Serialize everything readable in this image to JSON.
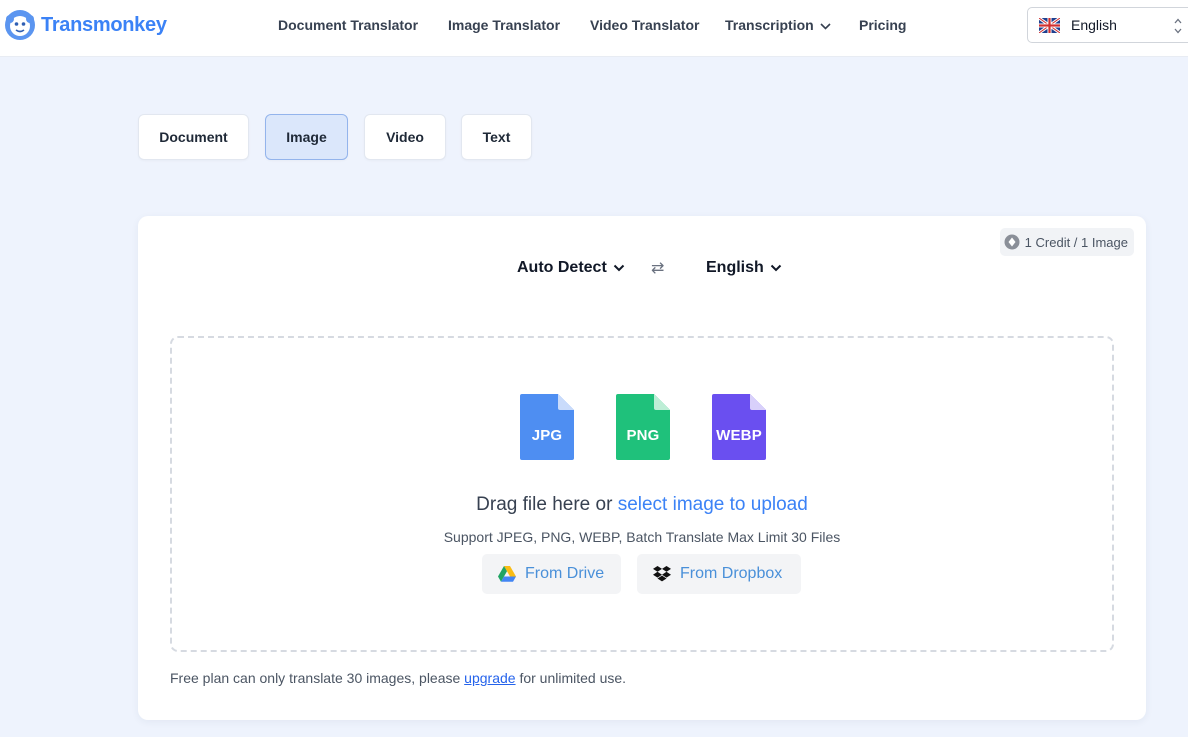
{
  "header": {
    "brand": "Transmonkey",
    "nav": [
      {
        "label": "Document Translator"
      },
      {
        "label": "Image Translator"
      },
      {
        "label": "Video Translator"
      },
      {
        "label": "Transcription"
      },
      {
        "label": "Pricing"
      }
    ],
    "language": "English"
  },
  "tabs": [
    {
      "label": "Document",
      "active": false
    },
    {
      "label": "Image",
      "active": true
    },
    {
      "label": "Video",
      "active": false
    },
    {
      "label": "Text",
      "active": false
    }
  ],
  "card": {
    "credit": "1 Credit / 1 Image",
    "source_lang": "Auto Detect",
    "swap_symbol": "⇄",
    "target_lang": "English",
    "file_types": [
      "JPG",
      "PNG",
      "WEBP"
    ],
    "drag_prefix": "Drag file here or",
    "drag_link": "select image to upload",
    "support": "Support JPEG, PNG, WEBP, Batch Translate Max Limit 30 Files",
    "drive_label": "From Drive",
    "dropbox_label": "From Dropbox",
    "note_prefix": "Free plan can only translate 30 images, please",
    "note_link": "upgrade",
    "note_suffix": "for unlimited use."
  },
  "colors": {
    "accent": "#3b82f6",
    "jpg": "#4e8ef2",
    "png": "#1fc17b",
    "webp": "#6a4ff0"
  }
}
